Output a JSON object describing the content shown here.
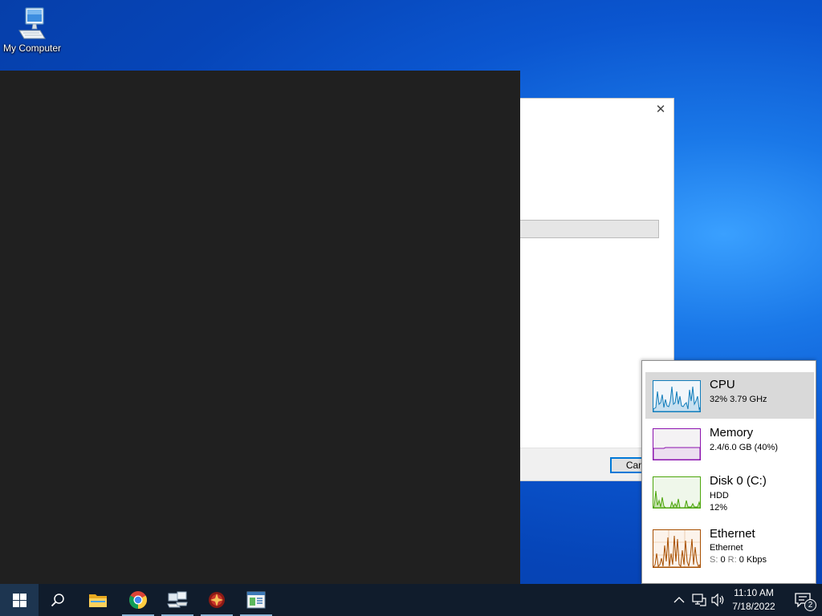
{
  "desktop": {
    "icons": [
      {
        "label": "My Computer",
        "icon": "computer-icon"
      }
    ]
  },
  "dialog": {
    "close_glyph": "✕",
    "cancel_label": "Cancel"
  },
  "perf_flyout": {
    "items": [
      {
        "name": "CPU",
        "line1": "32%  3.79 GHz",
        "color": "#117dbb",
        "fill": "#f1f6fa",
        "selected": true
      },
      {
        "name": "Memory",
        "line1": "2.4/6.0 GB (40%)",
        "color": "#8b12ae",
        "fill": "#f4f2f4",
        "selected": false
      },
      {
        "name": "Disk 0 (C:)",
        "line1": "HDD",
        "line2": "12%",
        "color": "#4da60c",
        "fill": "#eff7ea",
        "selected": false
      },
      {
        "name": "Ethernet",
        "line1": "Ethernet",
        "send_label": "S:",
        "send_value": "0",
        "recv_label": "R:",
        "recv_value": "0 Kbps",
        "color": "#a74f01",
        "fill": "#fcf3eb",
        "selected": false
      }
    ]
  },
  "taskbar": {
    "apps": [
      {
        "name": "start",
        "icon": "windows-logo-icon"
      },
      {
        "name": "search",
        "icon": "search-icon"
      },
      {
        "name": "file-explorer",
        "icon": "folder-icon"
      },
      {
        "name": "chrome",
        "icon": "chrome-icon"
      },
      {
        "name": "network-app",
        "icon": "network-computers-icon"
      },
      {
        "name": "game-app",
        "icon": "game-icon"
      },
      {
        "name": "task-manager",
        "icon": "task-manager-icon"
      }
    ],
    "tray": {
      "time": "11:10 AM",
      "date": "7/18/2022",
      "notification_count": "2"
    }
  }
}
